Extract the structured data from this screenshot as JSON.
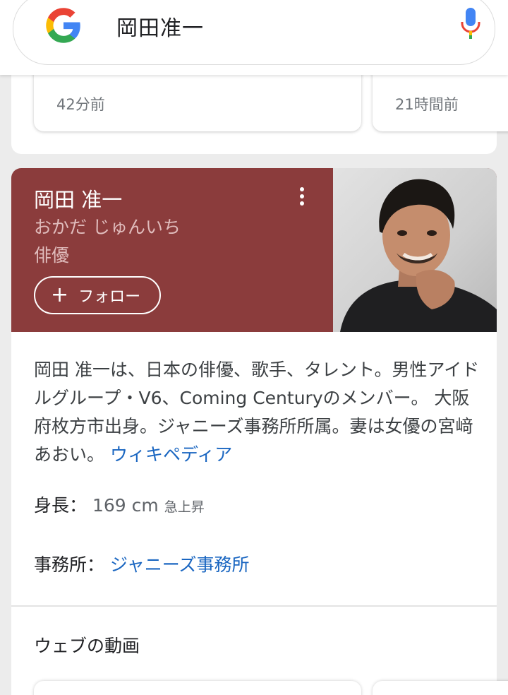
{
  "search": {
    "query": "岡田准一"
  },
  "news": {
    "items": [
      {
        "time": "42分前"
      },
      {
        "time": "21時間前"
      }
    ]
  },
  "knowledge_panel": {
    "name": "岡田 准一",
    "reading": "おかだ じゅんいち",
    "type": "俳優",
    "follow_label": "フォロー",
    "description": "岡田 准一は、日本の俳優、歌手、タレント。男性アイドルグループ・V6、Coming Centuryのメンバー。 大阪府枚方市出身。ジャニーズ事務所所属。妻は女優の宮﨑あおい。",
    "wiki_link": "ウィキペディア",
    "height_label": "身長：",
    "height_value": "169 cm",
    "height_note": "急上昇",
    "agency_label": "事務所：",
    "agency_value": "ジャニーズ事務所",
    "videos_title": "ウェブの動画",
    "header_color": "#8b3c3c",
    "link_color": "#1a66c1"
  }
}
